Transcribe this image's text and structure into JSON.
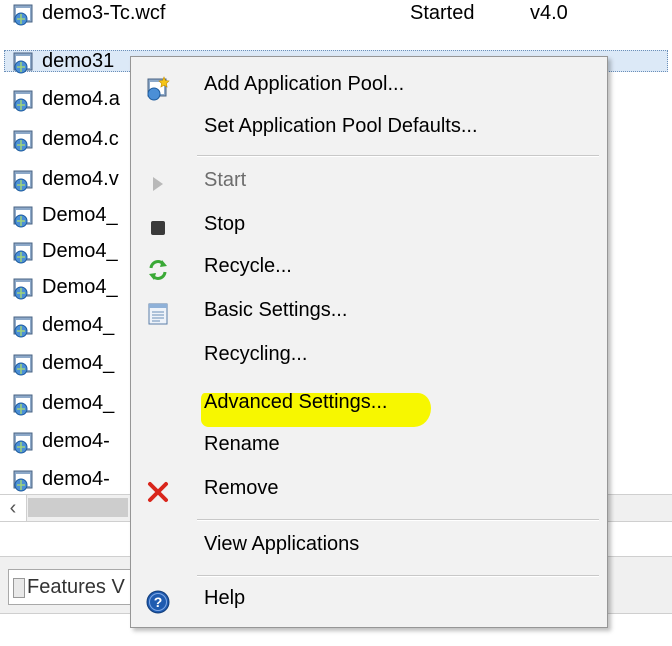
{
  "pool_list": {
    "rows": [
      {
        "name": "demo3-Tc.wcf",
        "status": "Started",
        "version": "v4.0"
      },
      {
        "name": "demo31",
        "status": "",
        "version": "",
        "selected": true
      },
      {
        "name": "demo4.a"
      },
      {
        "name": "demo4.c"
      },
      {
        "name": "demo4.v"
      },
      {
        "name": "Demo4_"
      },
      {
        "name": "Demo4_"
      },
      {
        "name": "Demo4_"
      },
      {
        "name": "demo4_"
      },
      {
        "name": "demo4_"
      },
      {
        "name": "demo4_"
      },
      {
        "name": "demo4-"
      },
      {
        "name": "demo4-"
      }
    ]
  },
  "scrollbar": {
    "left_arrow": "‹"
  },
  "bottom": {
    "features_tab_label": "Features V"
  },
  "context_menu": {
    "items": [
      {
        "label": "Add Application Pool...",
        "icon": "app-pool-add-icon"
      },
      {
        "label": "Set Application Pool Defaults..."
      },
      {
        "label": "Start",
        "icon": "play-icon",
        "disabled": true
      },
      {
        "label": "Stop",
        "icon": "stop-icon"
      },
      {
        "label": "Recycle...",
        "icon": "recycle-icon"
      },
      {
        "label": "Basic Settings...",
        "icon": "settings-window-icon"
      },
      {
        "label": "Recycling..."
      },
      {
        "label": "Advanced Settings...",
        "highlighted": true
      },
      {
        "label": "Rename"
      },
      {
        "label": "Remove",
        "icon": "remove-x-icon"
      },
      {
        "label": "View Applications"
      },
      {
        "label": "Help",
        "icon": "help-icon"
      }
    ]
  },
  "colors": {
    "highlight": "#f7f700",
    "menu_background": "#f2f2f2",
    "selection": "#dce9f7",
    "stop": "#3a3a3a",
    "recycle": "#3aa936",
    "remove": "#d9261c",
    "help": "#1f5bb0"
  }
}
